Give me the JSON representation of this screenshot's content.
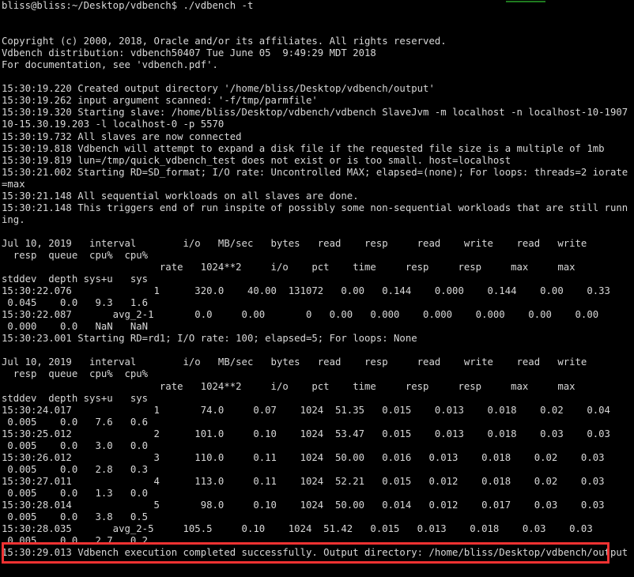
{
  "terminal": {
    "title": "vdbench terminal output",
    "prompt": "bliss@bliss:~/Desktop/vdbench$",
    "command": "./vdbench -t",
    "background_color": "#000000",
    "text_color": "#d8d8d8",
    "accent_green": "#1f7a1f",
    "highlight_border_color": "#f03232",
    "lines": [
      "bliss@bliss:~/Desktop/vdbench$ ./vdbench -t",
      "",
      "",
      "Copyright (c) 2000, 2018, Oracle and/or its affiliates. All rights reserved.",
      "Vdbench distribution: vdbench50407 Tue June 05  9:49:29 MDT 2018",
      "For documentation, see 'vdbench.pdf'.",
      "",
      "15:30:19.220 Created output directory '/home/bliss/Desktop/vdbench/output'",
      "15:30:19.262 input argument scanned: '-f/tmp/parmfile'",
      "15:30:19.320 Starting slave: /home/bliss/Desktop/vdbench/vdbench SlaveJvm -m localhost -n localhost-10-1907",
      "10-15.30.19.203 -l localhost-0 -p 5570",
      "15:30:19.732 All slaves are now connected",
      "15:30:19.818 Vdbench will attempt to expand a disk file if the requested file size is a multiple of 1mb",
      "15:30:19.819 lun=/tmp/quick_vdbench_test does not exist or is too small. host=localhost",
      "15:30:21.002 Starting RD=SD_format; I/O rate: Uncontrolled MAX; elapsed=(none); For loops: threads=2 iorate",
      "=max",
      "15:30:21.148 All sequential workloads on all slaves are done.",
      "15:30:21.148 This triggers end of run inspite of possibly some non-sequential workloads that are still runn",
      "ing.",
      "",
      "Jul 10, 2019   interval        i/o   MB/sec   bytes   read    resp     read    write    read   write",
      "  resp  queue  cpu%  cpu%",
      "                           rate   1024**2     i/o    pct    time     resp     resp     max     max",
      "stddev  depth sys+u   sys",
      "15:30:22.076              1      320.0    40.00  131072   0.00   0.144    0.000    0.144    0.00    0.33",
      " 0.045    0.0   9.3   1.6",
      "15:30:22.087       avg_2-1       0.0     0.00       0   0.00   0.000    0.000    0.000    0.00    0.00",
      " 0.000    0.0   NaN   NaN",
      "15:30:23.001 Starting RD=rd1; I/O rate: 100; elapsed=5; For loops: None",
      "",
      "Jul 10, 2019   interval        i/o   MB/sec   bytes   read    resp     read    write    read   write",
      "  resp  queue  cpu%  cpu%",
      "                           rate   1024**2     i/o    pct    time     resp     resp     max     max",
      "stddev  depth sys+u   sys",
      "15:30:24.017              1       74.0     0.07    1024  51.35   0.015    0.013    0.018    0.02    0.04",
      " 0.005    0.0   7.6   0.6",
      "15:30:25.012              2      101.0     0.10    1024  53.47   0.015    0.013    0.018    0.03    0.03",
      " 0.005    0.0   3.0   0.0",
      "15:30:26.012              3      110.0     0.11    1024  50.00   0.016   0.013    0.018    0.02    0.03",
      " 0.005    0.0   2.8   0.3",
      "15:30:27.011              4      113.0     0.11    1024  52.21   0.015   0.012    0.018    0.02    0.03",
      " 0.005    0.0   1.3   0.0",
      "15:30:28.014              5       98.0     0.10    1024  50.00   0.014   0.012    0.017    0.03    0.03",
      " 0.005    0.0   3.8   0.5",
      "15:30:28.035       avg_2-5     105.5     0.10    1024  51.42   0.015   0.013    0.018    0.03    0.03",
      " 0.005    0.0   2.7   0.2",
      "15:30:29.013 Vdbench execution completed successfully. Output directory: /home/bliss/Desktop/vdbench/output"
    ],
    "highlighted_line_index": 46,
    "highlighted_line_text": "15:30:29.013 Vdbench execution completed successfully. Output directory: /home/bliss/Desktop/vdbench/output"
  },
  "tables": [
    {
      "name": "sd-format-report",
      "date_label": "Jul 10, 2019",
      "headers_row1": [
        "interval",
        "i/o",
        "MB/sec",
        "bytes",
        "read",
        "resp",
        "read",
        "write",
        "read",
        "write"
      ],
      "headers_row1b": [
        "resp",
        "queue",
        "cpu%",
        "cpu%"
      ],
      "headers_row2": [
        "rate",
        "1024**2",
        "i/o",
        "pct",
        "time",
        "resp",
        "resp",
        "max",
        "max"
      ],
      "headers_row2b": [
        "stddev",
        "depth",
        "sys+u",
        "sys"
      ],
      "rows": [
        {
          "timestamp": "15:30:22.076",
          "interval": "1",
          "io_rate": "320.0",
          "mb_sec": "40.00",
          "bytes_io": "131072",
          "read_pct": "0.00",
          "resp_time": "0.144",
          "read_resp": "0.000",
          "write_resp": "0.144",
          "read_max": "0.00",
          "write_max": "0.33",
          "resp_stddev": "0.045",
          "queue_depth": "0.0",
          "cpu_sys_u": "9.3",
          "cpu_sys": "1.6"
        },
        {
          "timestamp": "15:30:22.087",
          "interval": "avg_2-1",
          "io_rate": "0.0",
          "mb_sec": "0.00",
          "bytes_io": "0",
          "read_pct": "0.00",
          "resp_time": "0.000",
          "read_resp": "0.000",
          "write_resp": "0.000",
          "read_max": "0.00",
          "write_max": "0.00",
          "resp_stddev": "0.000",
          "queue_depth": "0.0",
          "cpu_sys_u": "NaN",
          "cpu_sys": "NaN"
        }
      ]
    },
    {
      "name": "rd1-report",
      "date_label": "Jul 10, 2019",
      "headers_row1": [
        "interval",
        "i/o",
        "MB/sec",
        "bytes",
        "read",
        "resp",
        "read",
        "write",
        "read",
        "write"
      ],
      "headers_row1b": [
        "resp",
        "queue",
        "cpu%",
        "cpu%"
      ],
      "headers_row2": [
        "rate",
        "1024**2",
        "i/o",
        "pct",
        "time",
        "resp",
        "resp",
        "max",
        "max"
      ],
      "headers_row2b": [
        "stddev",
        "depth",
        "sys+u",
        "sys"
      ],
      "rows": [
        {
          "timestamp": "15:30:24.017",
          "interval": "1",
          "io_rate": "74.0",
          "mb_sec": "0.07",
          "bytes_io": "1024",
          "read_pct": "51.35",
          "resp_time": "0.015",
          "read_resp": "0.013",
          "write_resp": "0.018",
          "read_max": "0.02",
          "write_max": "0.04",
          "resp_stddev": "0.005",
          "queue_depth": "0.0",
          "cpu_sys_u": "7.6",
          "cpu_sys": "0.6"
        },
        {
          "timestamp": "15:30:25.012",
          "interval": "2",
          "io_rate": "101.0",
          "mb_sec": "0.10",
          "bytes_io": "1024",
          "read_pct": "53.47",
          "resp_time": "0.015",
          "read_resp": "0.013",
          "write_resp": "0.018",
          "read_max": "0.03",
          "write_max": "0.03",
          "resp_stddev": "0.005",
          "queue_depth": "0.0",
          "cpu_sys_u": "3.0",
          "cpu_sys": "0.0"
        },
        {
          "timestamp": "15:30:26.012",
          "interval": "3",
          "io_rate": "110.0",
          "mb_sec": "0.11",
          "bytes_io": "1024",
          "read_pct": "50.00",
          "resp_time": "0.016",
          "read_resp": "0.013",
          "write_resp": "0.018",
          "read_max": "0.02",
          "write_max": "0.03",
          "resp_stddev": "0.005",
          "queue_depth": "0.0",
          "cpu_sys_u": "2.8",
          "cpu_sys": "0.3"
        },
        {
          "timestamp": "15:30:27.011",
          "interval": "4",
          "io_rate": "113.0",
          "mb_sec": "0.11",
          "bytes_io": "1024",
          "read_pct": "52.21",
          "resp_time": "0.015",
          "read_resp": "0.012",
          "write_resp": "0.018",
          "read_max": "0.02",
          "write_max": "0.03",
          "resp_stddev": "0.005",
          "queue_depth": "0.0",
          "cpu_sys_u": "1.3",
          "cpu_sys": "0.0"
        },
        {
          "timestamp": "15:30:28.014",
          "interval": "5",
          "io_rate": "98.0",
          "mb_sec": "0.10",
          "bytes_io": "1024",
          "read_pct": "50.00",
          "resp_time": "0.014",
          "read_resp": "0.012",
          "write_resp": "0.017",
          "read_max": "0.03",
          "write_max": "0.03",
          "resp_stddev": "0.005",
          "queue_depth": "0.0",
          "cpu_sys_u": "3.8",
          "cpu_sys": "0.5"
        },
        {
          "timestamp": "15:30:28.035",
          "interval": "avg_2-5",
          "io_rate": "105.5",
          "mb_sec": "0.10",
          "bytes_io": "1024",
          "read_pct": "51.42",
          "resp_time": "0.015",
          "read_resp": "0.013",
          "write_resp": "0.018",
          "read_max": "0.03",
          "write_max": "0.03",
          "resp_stddev": "0.005",
          "queue_depth": "0.0",
          "cpu_sys_u": "2.7",
          "cpu_sys": "0.2"
        }
      ]
    }
  ]
}
